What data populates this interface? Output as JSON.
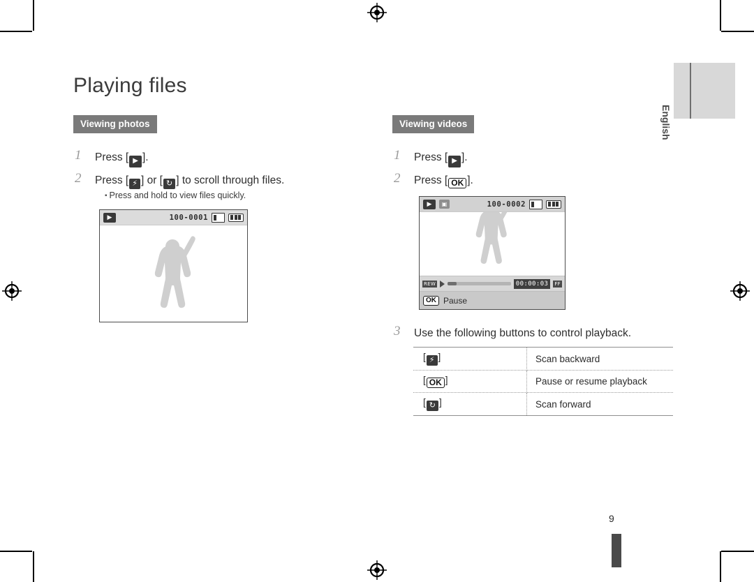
{
  "document": {
    "title": "Playing files",
    "page_number": "9",
    "language_tab": "English"
  },
  "sections": {
    "photos": {
      "heading": "Viewing photos",
      "steps": [
        {
          "num": "1",
          "pre": "Press [",
          "key": "play-icon",
          "post": "]."
        },
        {
          "num": "2",
          "pre": "Press [",
          "key1": "flash-icon",
          "mid": "] or [",
          "key2": "timer-icon",
          "post": "] to scroll through files."
        }
      ],
      "note": "Press and hold to view files quickly.",
      "lcd": {
        "file_number": "100-0001",
        "badge": "play-icon",
        "card_icon": "memory-card-icon",
        "battery_icon": "battery-full-icon"
      }
    },
    "videos": {
      "heading": "Viewing videos",
      "steps": [
        {
          "num": "1",
          "pre": "Press [",
          "key": "play-icon",
          "post": "]."
        },
        {
          "num": "2",
          "pre": "Press [",
          "key": "OK",
          "post": "]."
        },
        {
          "num": "3",
          "text": "Use the following buttons to control playback."
        }
      ],
      "lcd": {
        "file_number": "100-0002",
        "badge": "play-icon",
        "movie_badge": "movie-icon",
        "card_icon": "memory-card-icon",
        "battery_icon": "battery-full-icon",
        "rew_label": "REW",
        "ff_label": "FF",
        "time": "00:00:03",
        "ok_chip": "OK",
        "pause_label": "Pause"
      },
      "button_table": {
        "rows": [
          {
            "key": "flash-icon",
            "key_text": "[ ]",
            "description": "Scan backward"
          },
          {
            "key": "ok",
            "key_text": "[OK]",
            "description": "Pause or resume playback"
          },
          {
            "key": "timer-icon",
            "key_text": "[ ]",
            "description": "Scan forward"
          }
        ]
      }
    }
  }
}
